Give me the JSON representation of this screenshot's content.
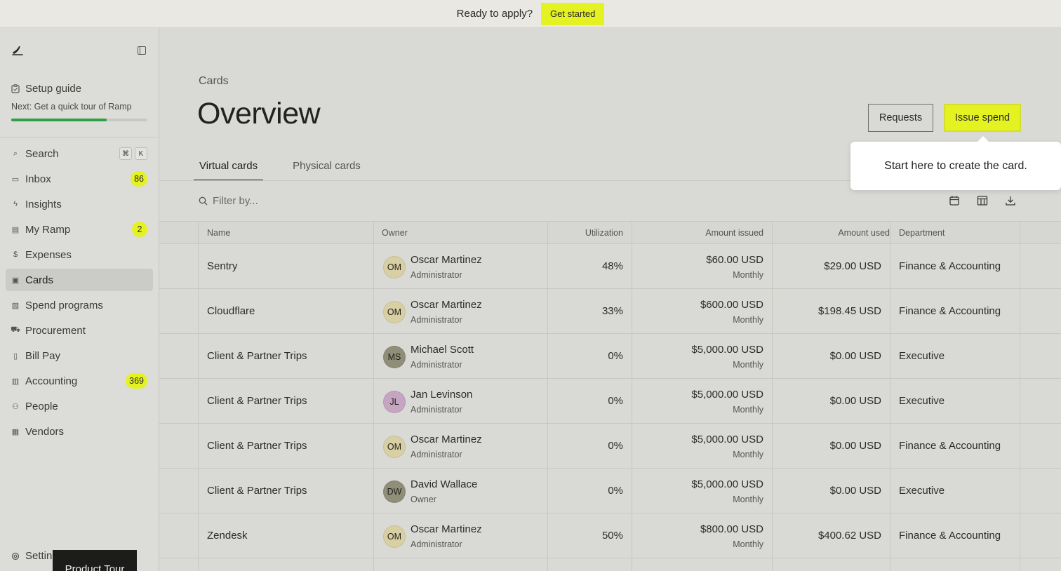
{
  "banner": {
    "text": "Ready to apply?",
    "button": "Get started"
  },
  "sidebar": {
    "setup": {
      "label": "Setup guide",
      "next": "Next: Get a quick tour of Ramp",
      "progress": 0.7
    },
    "search_shortcut": [
      "⌘",
      "K"
    ],
    "items": [
      {
        "label": "Search",
        "icon": "search-icon",
        "badge": null
      },
      {
        "label": "Inbox",
        "icon": "inbox-icon",
        "badge": "86"
      },
      {
        "label": "Insights",
        "icon": "bolt-icon",
        "badge": null
      },
      {
        "label": "My Ramp",
        "icon": "card-icon",
        "badge": "2"
      },
      {
        "label": "Expenses",
        "icon": "dollar-icon",
        "badge": null
      },
      {
        "label": "Cards",
        "icon": "cards-icon",
        "badge": null,
        "active": true
      },
      {
        "label": "Spend programs",
        "icon": "program-icon",
        "badge": null
      },
      {
        "label": "Procurement",
        "icon": "cart-icon",
        "badge": null
      },
      {
        "label": "Bill Pay",
        "icon": "bill-icon",
        "badge": null
      },
      {
        "label": "Accounting",
        "icon": "book-icon",
        "badge": "369"
      },
      {
        "label": "People",
        "icon": "people-icon",
        "badge": null
      },
      {
        "label": "Vendors",
        "icon": "store-icon",
        "badge": null
      }
    ],
    "settings": "Settings",
    "product_tour": "Product Tour"
  },
  "main": {
    "breadcrumb": "Cards",
    "title": "Overview",
    "requests_button": "Requests",
    "issue_button": "Issue spend",
    "tooltip": "Start here to create the card.",
    "tabs": [
      "Virtual cards",
      "Physical cards"
    ],
    "filter_placeholder": "Filter by...",
    "columns": [
      "Name",
      "Owner",
      "Utilization",
      "Amount issued",
      "Amount used",
      "Department"
    ],
    "rows": [
      {
        "name": "Sentry",
        "initials": "OM",
        "owner": "Oscar Martinez",
        "role": "Administrator",
        "util": "48%",
        "issued": "$60.00 USD",
        "period": "Monthly",
        "used": "$29.00 USD",
        "dept": "Finance & Accounting",
        "avatar_color": "#d8d0a4"
      },
      {
        "name": "Cloudflare",
        "initials": "OM",
        "owner": "Oscar Martinez",
        "role": "Administrator",
        "util": "33%",
        "issued": "$600.00 USD",
        "period": "Monthly",
        "used": "$198.45 USD",
        "dept": "Finance & Accounting",
        "avatar_color": "#d8d0a4"
      },
      {
        "name": "Client & Partner Trips",
        "initials": "MS",
        "owner": "Michael Scott",
        "role": "Administrator",
        "util": "0%",
        "issued": "$5,000.00 USD",
        "period": "Monthly",
        "used": "$0.00 USD",
        "dept": "Executive",
        "avatar_color": "#8f8e78"
      },
      {
        "name": "Client & Partner Trips",
        "initials": "JL",
        "owner": "Jan Levinson",
        "role": "Administrator",
        "util": "0%",
        "issued": "$5,000.00 USD",
        "period": "Monthly",
        "used": "$0.00 USD",
        "dept": "Executive",
        "avatar_color": "#c6a5c2"
      },
      {
        "name": "Client & Partner Trips",
        "initials": "OM",
        "owner": "Oscar Martinez",
        "role": "Administrator",
        "util": "0%",
        "issued": "$5,000.00 USD",
        "period": "Monthly",
        "used": "$0.00 USD",
        "dept": "Finance & Accounting",
        "avatar_color": "#d8d0a4"
      },
      {
        "name": "Client & Partner Trips",
        "initials": "DW",
        "owner": "David Wallace",
        "role": "Owner",
        "util": "0%",
        "issued": "$5,000.00 USD",
        "period": "Monthly",
        "used": "$0.00 USD",
        "dept": "Executive",
        "avatar_color": "#8f8e78"
      },
      {
        "name": "Zendesk",
        "initials": "OM",
        "owner": "Oscar Martinez",
        "role": "Administrator",
        "util": "50%",
        "issued": "$800.00 USD",
        "period": "Monthly",
        "used": "$400.62 USD",
        "dept": "Finance & Accounting",
        "avatar_color": "#d8d0a4"
      }
    ]
  }
}
